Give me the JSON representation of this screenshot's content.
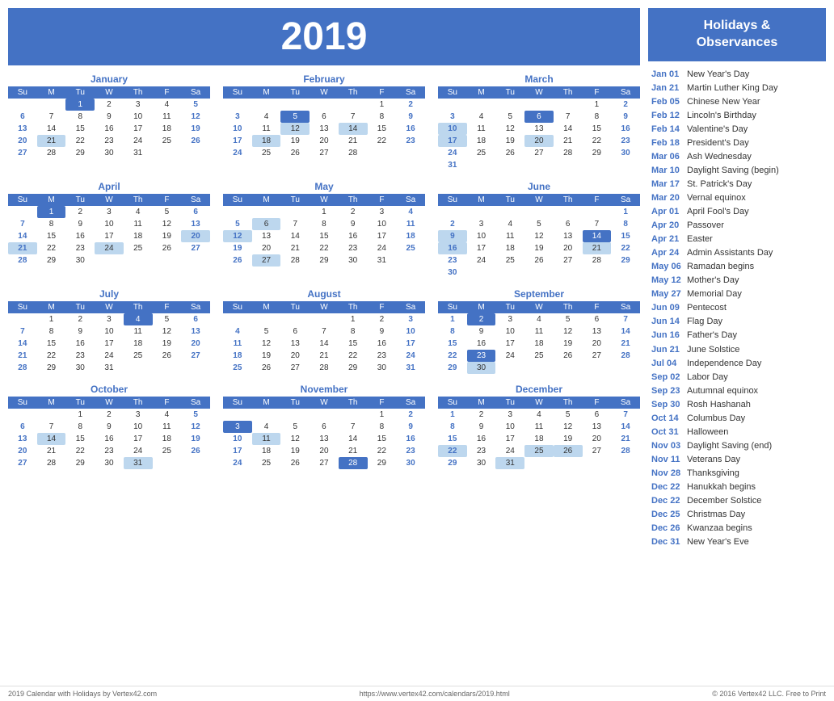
{
  "year": "2019",
  "months": [
    {
      "name": "January",
      "weeks": [
        [
          "",
          "",
          "1",
          "2",
          "3",
          "4",
          "5"
        ],
        [
          "6",
          "7",
          "8",
          "9",
          "10",
          "11",
          "12"
        ],
        [
          "13",
          "14",
          "15",
          "16",
          "17",
          "18",
          "19"
        ],
        [
          "20",
          "21",
          "22",
          "23",
          "24",
          "25",
          "26"
        ],
        [
          "27",
          "28",
          "29",
          "30",
          "31",
          "",
          ""
        ]
      ],
      "highlights": {
        "1": "dark",
        "21": "light"
      }
    },
    {
      "name": "February",
      "weeks": [
        [
          "",
          "",
          "",
          "",
          "",
          "1",
          "2"
        ],
        [
          "3",
          "4",
          "5",
          "6",
          "7",
          "8",
          "9"
        ],
        [
          "10",
          "11",
          "12",
          "13",
          "14",
          "15",
          "16"
        ],
        [
          "17",
          "18",
          "19",
          "20",
          "21",
          "22",
          "23"
        ],
        [
          "24",
          "25",
          "26",
          "27",
          "28",
          "",
          ""
        ]
      ],
      "highlights": {
        "5": "dark",
        "12": "light",
        "14": "light",
        "18": "light"
      }
    },
    {
      "name": "March",
      "weeks": [
        [
          "",
          "",
          "",
          "",
          "",
          "1",
          "2"
        ],
        [
          "3",
          "4",
          "5",
          "6",
          "7",
          "8",
          "9"
        ],
        [
          "10",
          "11",
          "12",
          "13",
          "14",
          "15",
          "16"
        ],
        [
          "17",
          "18",
          "19",
          "20",
          "21",
          "22",
          "23"
        ],
        [
          "24",
          "25",
          "26",
          "27",
          "28",
          "29",
          "30"
        ],
        [
          "31",
          "",
          "",
          "",
          "",
          "",
          ""
        ]
      ],
      "highlights": {
        "6": "dark",
        "10": "light",
        "17": "light",
        "20": "light"
      }
    },
    {
      "name": "April",
      "weeks": [
        [
          "",
          "1",
          "2",
          "3",
          "4",
          "5",
          "6"
        ],
        [
          "7",
          "8",
          "9",
          "10",
          "11",
          "12",
          "13"
        ],
        [
          "14",
          "15",
          "16",
          "17",
          "18",
          "19",
          "20"
        ],
        [
          "21",
          "22",
          "23",
          "24",
          "25",
          "26",
          "27"
        ],
        [
          "28",
          "29",
          "30",
          "",
          "",
          "",
          ""
        ]
      ],
      "highlights": {
        "1": "dark",
        "20": "light",
        "21": "light",
        "24": "light"
      }
    },
    {
      "name": "May",
      "weeks": [
        [
          "",
          "",
          "",
          "1",
          "2",
          "3",
          "4"
        ],
        [
          "5",
          "6",
          "7",
          "8",
          "9",
          "10",
          "11"
        ],
        [
          "12",
          "13",
          "14",
          "15",
          "16",
          "17",
          "18"
        ],
        [
          "19",
          "20",
          "21",
          "22",
          "23",
          "24",
          "25"
        ],
        [
          "26",
          "27",
          "28",
          "29",
          "30",
          "31",
          ""
        ]
      ],
      "highlights": {
        "6": "light",
        "12": "light",
        "27": "light"
      }
    },
    {
      "name": "June",
      "weeks": [
        [
          "",
          "",
          "",
          "",
          "",
          "",
          "1"
        ],
        [
          "2",
          "3",
          "4",
          "5",
          "6",
          "7",
          "8"
        ],
        [
          "9",
          "10",
          "11",
          "12",
          "13",
          "14",
          "15"
        ],
        [
          "16",
          "17",
          "18",
          "19",
          "20",
          "21",
          "22"
        ],
        [
          "23",
          "24",
          "25",
          "26",
          "27",
          "28",
          "29"
        ],
        [
          "30",
          "",
          "",
          "",
          "",
          "",
          ""
        ]
      ],
      "highlights": {
        "9": "light",
        "14": "dark",
        "16": "light",
        "21": "light"
      }
    },
    {
      "name": "July",
      "weeks": [
        [
          "",
          "1",
          "2",
          "3",
          "4",
          "5",
          "6"
        ],
        [
          "7",
          "8",
          "9",
          "10",
          "11",
          "12",
          "13"
        ],
        [
          "14",
          "15",
          "16",
          "17",
          "18",
          "19",
          "20"
        ],
        [
          "21",
          "22",
          "23",
          "24",
          "25",
          "26",
          "27"
        ],
        [
          "28",
          "29",
          "30",
          "31",
          "",
          "",
          ""
        ]
      ],
      "highlights": {
        "4": "dark"
      }
    },
    {
      "name": "August",
      "weeks": [
        [
          "",
          "",
          "",
          "",
          "1",
          "2",
          "3"
        ],
        [
          "4",
          "5",
          "6",
          "7",
          "8",
          "9",
          "10"
        ],
        [
          "11",
          "12",
          "13",
          "14",
          "15",
          "16",
          "17"
        ],
        [
          "18",
          "19",
          "20",
          "21",
          "22",
          "23",
          "24"
        ],
        [
          "25",
          "26",
          "27",
          "28",
          "29",
          "30",
          "31"
        ]
      ],
      "highlights": {}
    },
    {
      "name": "September",
      "weeks": [
        [
          "1",
          "2",
          "3",
          "4",
          "5",
          "6",
          "7"
        ],
        [
          "8",
          "9",
          "10",
          "11",
          "12",
          "13",
          "14"
        ],
        [
          "15",
          "16",
          "17",
          "18",
          "19",
          "20",
          "21"
        ],
        [
          "22",
          "23",
          "24",
          "25",
          "26",
          "27",
          "28"
        ],
        [
          "29",
          "30",
          "",
          "",
          "",
          "",
          ""
        ]
      ],
      "highlights": {
        "2": "dark",
        "23": "dark",
        "30": "light"
      }
    },
    {
      "name": "October",
      "weeks": [
        [
          "",
          "",
          "1",
          "2",
          "3",
          "4",
          "5"
        ],
        [
          "6",
          "7",
          "8",
          "9",
          "10",
          "11",
          "12"
        ],
        [
          "13",
          "14",
          "15",
          "16",
          "17",
          "18",
          "19"
        ],
        [
          "20",
          "21",
          "22",
          "23",
          "24",
          "25",
          "26"
        ],
        [
          "27",
          "28",
          "29",
          "30",
          "31",
          "",
          ""
        ]
      ],
      "highlights": {
        "14": "light",
        "31": "light"
      }
    },
    {
      "name": "November",
      "weeks": [
        [
          "",
          "",
          "",
          "",
          "",
          "1",
          "2"
        ],
        [
          "3",
          "4",
          "5",
          "6",
          "7",
          "8",
          "9"
        ],
        [
          "10",
          "11",
          "12",
          "13",
          "14",
          "15",
          "16"
        ],
        [
          "17",
          "18",
          "19",
          "20",
          "21",
          "22",
          "23"
        ],
        [
          "24",
          "25",
          "26",
          "27",
          "28",
          "29",
          "30"
        ]
      ],
      "highlights": {
        "3": "dark",
        "11": "light",
        "28": "dark"
      }
    },
    {
      "name": "December",
      "weeks": [
        [
          "1",
          "2",
          "3",
          "4",
          "5",
          "6",
          "7"
        ],
        [
          "8",
          "9",
          "10",
          "11",
          "12",
          "13",
          "14"
        ],
        [
          "15",
          "16",
          "17",
          "18",
          "19",
          "20",
          "21"
        ],
        [
          "22",
          "23",
          "24",
          "25",
          "26",
          "27",
          "28"
        ],
        [
          "29",
          "30",
          "31",
          "",
          "",
          "",
          ""
        ]
      ],
      "highlights": {
        "22": "light",
        "25": "light",
        "26": "light",
        "31": "light"
      }
    }
  ],
  "holidays_header": "Holidays &\nObservances",
  "holidays": [
    {
      "date": "Jan 01",
      "name": "New Year's Day"
    },
    {
      "date": "Jan 21",
      "name": "Martin Luther King Day"
    },
    {
      "date": "Feb 05",
      "name": "Chinese New Year"
    },
    {
      "date": "Feb 12",
      "name": "Lincoln's Birthday"
    },
    {
      "date": "Feb 14",
      "name": "Valentine's Day"
    },
    {
      "date": "Feb 18",
      "name": "President's Day"
    },
    {
      "date": "Mar 06",
      "name": "Ash Wednesday"
    },
    {
      "date": "Mar 10",
      "name": "Daylight Saving (begin)"
    },
    {
      "date": "Mar 17",
      "name": "St. Patrick's Day"
    },
    {
      "date": "Mar 20",
      "name": "Vernal equinox"
    },
    {
      "date": "Apr 01",
      "name": "April Fool's Day"
    },
    {
      "date": "Apr 20",
      "name": "Passover"
    },
    {
      "date": "Apr 21",
      "name": "Easter"
    },
    {
      "date": "Apr 24",
      "name": "Admin Assistants Day"
    },
    {
      "date": "May 06",
      "name": "Ramadan begins"
    },
    {
      "date": "May 12",
      "name": "Mother's Day"
    },
    {
      "date": "May 27",
      "name": "Memorial Day"
    },
    {
      "date": "Jun 09",
      "name": "Pentecost"
    },
    {
      "date": "Jun 14",
      "name": "Flag Day"
    },
    {
      "date": "Jun 16",
      "name": "Father's Day"
    },
    {
      "date": "Jun 21",
      "name": "June Solstice"
    },
    {
      "date": "Jul 04",
      "name": "Independence Day"
    },
    {
      "date": "Sep 02",
      "name": "Labor Day"
    },
    {
      "date": "Sep 23",
      "name": "Autumnal equinox"
    },
    {
      "date": "Sep 30",
      "name": "Rosh Hashanah"
    },
    {
      "date": "Oct 14",
      "name": "Columbus Day"
    },
    {
      "date": "Oct 31",
      "name": "Halloween"
    },
    {
      "date": "Nov 03",
      "name": "Daylight Saving (end)"
    },
    {
      "date": "Nov 11",
      "name": "Veterans Day"
    },
    {
      "date": "Nov 28",
      "name": "Thanksgiving"
    },
    {
      "date": "Dec 22",
      "name": "Hanukkah begins"
    },
    {
      "date": "Dec 22",
      "name": "December Solstice"
    },
    {
      "date": "Dec 25",
      "name": "Christmas Day"
    },
    {
      "date": "Dec 26",
      "name": "Kwanzaa begins"
    },
    {
      "date": "Dec 31",
      "name": "New Year's Eve"
    }
  ],
  "footer": {
    "left": "2019 Calendar with Holidays by Vertex42.com",
    "center": "https://www.vertex42.com/calendars/2019.html",
    "right": "© 2016 Vertex42 LLC. Free to Print"
  }
}
